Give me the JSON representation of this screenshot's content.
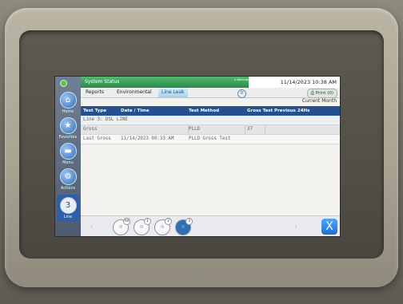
{
  "status": {
    "title": "System Status",
    "alarms": "0 Warnings 0 Alarms",
    "datetime": "11/14/2023 10:38 AM"
  },
  "tabs": [
    {
      "label": "Reports"
    },
    {
      "label": "Environmental"
    },
    {
      "label": "Line Leak"
    }
  ],
  "tab_circle": "0",
  "print_label": "Print (0)",
  "period": "Current Month",
  "columns": [
    "Test Type",
    "Date / Time",
    "Test Method",
    "Gross Test Previous 24Hs"
  ],
  "rows": {
    "group": "Line 3: DSL LINE",
    "gross": {
      "type": "Gross",
      "date": "",
      "method": "PLLD",
      "result": "37"
    },
    "last": {
      "type": "Last Gross",
      "date": "11/14/2023 09:33 AM",
      "method": "PLLD Gross Test",
      "result": ""
    }
  },
  "nav": [
    {
      "label": "Home",
      "icon": "home-icon"
    },
    {
      "label": "Favorites",
      "icon": "star-icon"
    },
    {
      "label": "Menu",
      "icon": "menu-icon"
    },
    {
      "label": "Actions",
      "icon": "actions-icon"
    },
    {
      "label": "Line",
      "value": "3"
    }
  ],
  "filters": [
    {
      "badge": "All"
    },
    {
      "badge": "1"
    },
    {
      "badge": "2"
    },
    {
      "badge": "3"
    }
  ],
  "close_label": "X"
}
